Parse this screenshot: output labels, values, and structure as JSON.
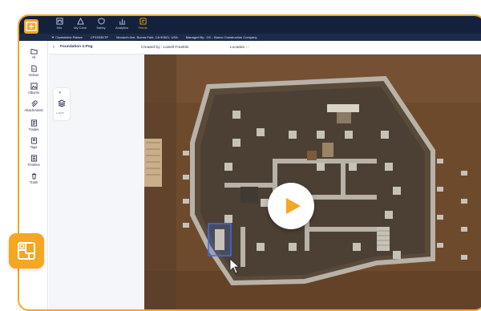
{
  "app": {
    "nav": [
      {
        "label": "Site",
        "icon": "site-icon",
        "active": false
      },
      {
        "label": "My Crew",
        "icon": "crew-icon",
        "active": false
      },
      {
        "label": "Safety",
        "icon": "shield-icon",
        "active": false
      },
      {
        "label": "Analytics",
        "icon": "chart-icon",
        "active": false
      },
      {
        "label": "Feeds",
        "icon": "feeds-icon",
        "active": true
      }
    ],
    "infobar": {
      "project": "▼ Crystalview Palace",
      "code": "CP1033KTP",
      "address": "Monarch Ave, Buena Park, CA 90621, USA",
      "manager": "Managed By : GC - Bueno Construction Company"
    }
  },
  "sidebar": {
    "items": [
      {
        "label": "All",
        "icon": "folder-icon"
      },
      {
        "label": "Videos",
        "icon": "video-file-icon"
      },
      {
        "label": "Albums",
        "icon": "album-icon"
      },
      {
        "label": "Attachments",
        "icon": "paperclip-icon"
      },
      {
        "label": "Trades",
        "icon": "trades-icon"
      },
      {
        "label": "Tags",
        "icon": "tag-icon"
      },
      {
        "label": "Timeline",
        "icon": "timeline-icon"
      },
      {
        "label": "Trash",
        "icon": "trash-icon"
      }
    ]
  },
  "header": {
    "back": "‹",
    "file_name": "Foundation 2.Png",
    "created_by": "Created by : Lowell Franklin",
    "location": "Location : -"
  },
  "viewer": {
    "collapse": "»",
    "layer_label": "Layer",
    "play_icon": "play-icon"
  },
  "colors": {
    "accent": "#f5a623",
    "nav_bg": "#14213d",
    "selection": "#3b6fe0"
  }
}
